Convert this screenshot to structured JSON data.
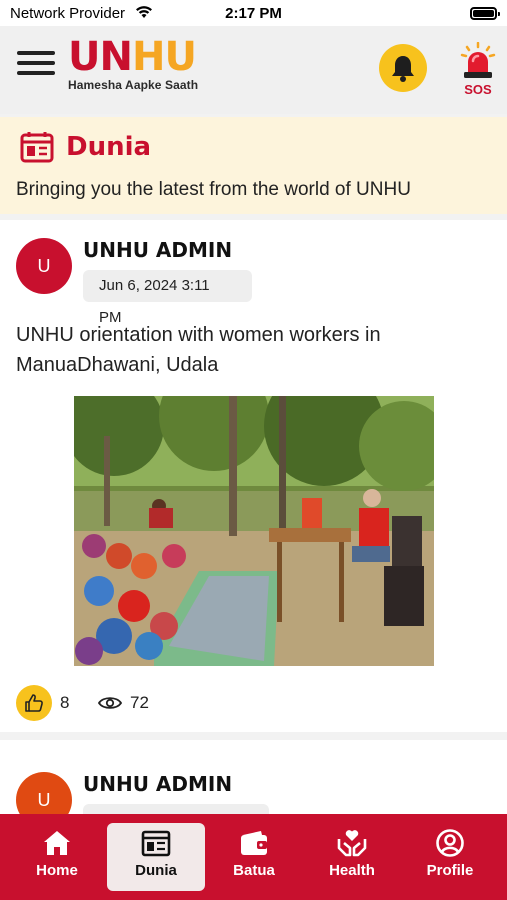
{
  "status_bar": {
    "carrier": "Network Provider",
    "time": "2:17 PM"
  },
  "header": {
    "logo": {
      "u1": "U",
      "n": "N",
      "h": "H",
      "u2": "U",
      "tagline": "Hamesha Aapke Saath"
    },
    "sos_label": "SOS"
  },
  "banner": {
    "title": "Dunia",
    "subtitle": "Bringing you the latest from the world of UNHU"
  },
  "posts": [
    {
      "avatar_initial": "U",
      "author": "UNHU ADMIN",
      "date": "Jun 6, 2024 3:11 PM",
      "caption": "UNHU orientation with women workers in ManuaDhawani, Udala",
      "likes": "8",
      "views": "72"
    },
    {
      "avatar_initial": "U",
      "author": "UNHU ADMIN"
    }
  ],
  "nav": {
    "items": [
      {
        "label": "Home",
        "icon": "home-icon"
      },
      {
        "label": "Dunia",
        "icon": "newspaper-icon",
        "active": true
      },
      {
        "label": "Batua",
        "icon": "wallet-icon"
      },
      {
        "label": "Health",
        "icon": "health-hands-icon"
      },
      {
        "label": "Profile",
        "icon": "profile-icon"
      }
    ]
  },
  "colors": {
    "brand_red": "#c8102e",
    "brand_yellow": "#f7c21d",
    "banner_bg": "#fdf4dc"
  }
}
